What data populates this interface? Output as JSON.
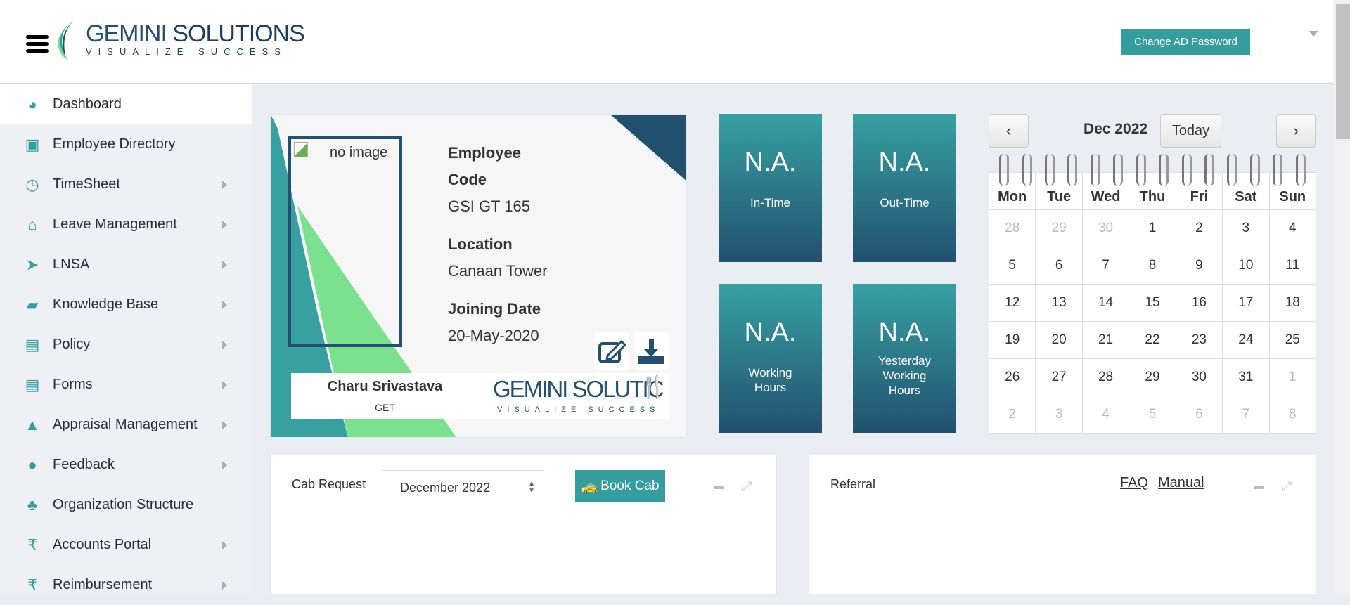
{
  "header": {
    "logo_main": "GEMINI",
    "logo_second": "SOLUTIONS",
    "tagline": "VISUALIZE SUCCESS",
    "change_password": "Change AD Password"
  },
  "sidebar": {
    "items": [
      {
        "label": "Dashboard",
        "icon": "dashboard-icon",
        "glyph": "◕",
        "arrow": false
      },
      {
        "label": "Employee Directory",
        "icon": "contact-book-icon",
        "glyph": "▣",
        "arrow": false
      },
      {
        "label": "TimeSheet",
        "icon": "clock-icon",
        "glyph": "◷",
        "arrow": true
      },
      {
        "label": "Leave Management",
        "icon": "home-icon",
        "glyph": "⌂",
        "arrow": true
      },
      {
        "label": "LNSA",
        "icon": "paper-plane-icon",
        "glyph": "➤",
        "arrow": true
      },
      {
        "label": "Knowledge Base",
        "icon": "folder-open-icon",
        "glyph": "▰",
        "arrow": true
      },
      {
        "label": "Policy",
        "icon": "file-icon",
        "glyph": "▤",
        "arrow": true
      },
      {
        "label": "Forms",
        "icon": "file-icon",
        "glyph": "▤",
        "arrow": true
      },
      {
        "label": "Appraisal Management",
        "icon": "graduation-cap-icon",
        "glyph": "▲",
        "arrow": true
      },
      {
        "label": "Feedback",
        "icon": "comments-icon",
        "glyph": "●",
        "arrow": true
      },
      {
        "label": "Organization Structure",
        "icon": "sitemap-icon",
        "glyph": "♣",
        "arrow": false
      },
      {
        "label": "Accounts Portal",
        "icon": "rupee-icon",
        "glyph": "₹",
        "arrow": true
      },
      {
        "label": "Reimbursement",
        "icon": "rupee-icon",
        "glyph": "₹",
        "arrow": true
      }
    ]
  },
  "card": {
    "photo_alt": "no image",
    "code_label": "Employee Code",
    "code": "GSI GT 165",
    "location_label": "Location",
    "location": "Canaan Tower",
    "joining_label": "Joining Date",
    "joining": "20-May-2020",
    "name": "Charu Srivastava",
    "designation": "GET",
    "logo_text": "GEMINI SOLUTIC",
    "logo_tagline": "VISUALIZE SUCCESS"
  },
  "tiles": [
    {
      "value": "N.A.",
      "label": "In-Time"
    },
    {
      "value": "N.A.",
      "label": "Out-Time"
    },
    {
      "value": "N.A.",
      "label": "Working Hours"
    },
    {
      "value": "N.A.",
      "label": "Yesterday Working Hours"
    }
  ],
  "calendar": {
    "title": "Dec 2022",
    "prev": "‹",
    "next": "›",
    "today": "Today",
    "days": [
      "Mon",
      "Tue",
      "Wed",
      "Thu",
      "Fri",
      "Sat",
      "Sun"
    ],
    "weeks": [
      [
        "28",
        "29",
        "30",
        "1",
        "2",
        "3",
        "4"
      ],
      [
        "5",
        "6",
        "7",
        "8",
        "9",
        "10",
        "11"
      ],
      [
        "12",
        "13",
        "14",
        "15",
        "16",
        "17",
        "18"
      ],
      [
        "19",
        "20",
        "21",
        "22",
        "23",
        "24",
        "25"
      ],
      [
        "26",
        "27",
        "28",
        "29",
        "30",
        "31",
        "1"
      ],
      [
        "2",
        "3",
        "4",
        "5",
        "6",
        "7",
        "8"
      ]
    ],
    "other": [
      [
        1,
        1,
        1,
        0,
        0,
        0,
        0
      ],
      [
        0,
        0,
        0,
        0,
        0,
        0,
        0
      ],
      [
        0,
        0,
        0,
        0,
        0,
        0,
        0
      ],
      [
        0,
        0,
        0,
        0,
        0,
        0,
        0
      ],
      [
        0,
        0,
        0,
        0,
        0,
        0,
        1
      ],
      [
        1,
        1,
        1,
        1,
        1,
        1,
        1
      ]
    ]
  },
  "cab": {
    "title": "Cab Request",
    "month": "December 2022",
    "book": "Book Cab"
  },
  "referral": {
    "title": "Referral",
    "faq": "FAQ",
    "manual": "Manual"
  },
  "colors": {
    "accent": "#349e9f",
    "navy": "#24506f",
    "green": "#7ae28f"
  }
}
